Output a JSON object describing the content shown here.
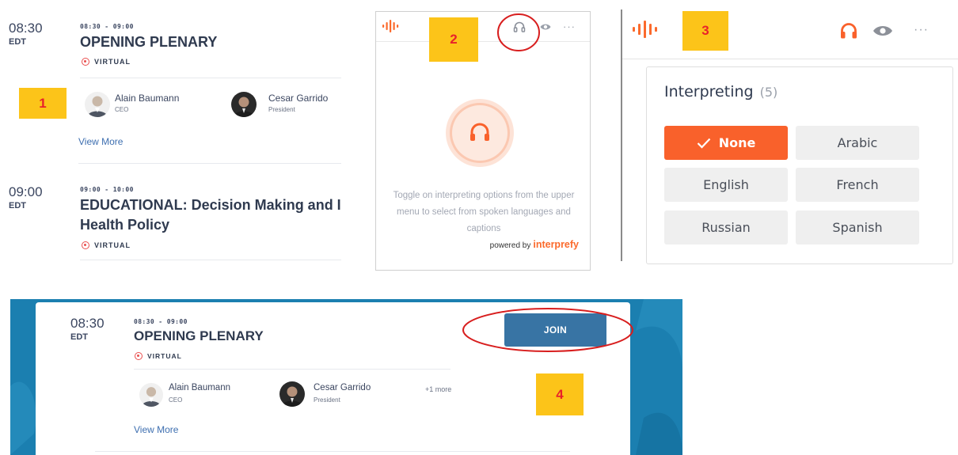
{
  "panel1": {
    "badge": "1",
    "slot1": {
      "time": "08:30",
      "tz": "EDT",
      "range": "08:30 - 09:00",
      "title": "OPENING PLENARY",
      "mode": "VIRTUAL",
      "speakers": [
        {
          "name": "Alain Baumann",
          "role": "CEO"
        },
        {
          "name": "Cesar Garrido",
          "role": "President"
        }
      ],
      "view_more": "View More"
    },
    "slot2": {
      "time": "09:00",
      "tz": "EDT",
      "range": "09:00 - 10:00",
      "title_line1": "EDUCATIONAL: Decision Making and I",
      "title_line2": "Health Policy",
      "mode": "VIRTUAL"
    }
  },
  "panel2": {
    "badge": "2",
    "help_text": "Toggle on interpreting options from the upper menu to select from spoken languages and captions",
    "powered_by": "powered by",
    "brand": "interprefy",
    "more": "···"
  },
  "panel3": {
    "badge": "3",
    "title": "Interpreting",
    "count": "(5)",
    "more": "···",
    "languages": [
      {
        "label": "None",
        "selected": true
      },
      {
        "label": "Arabic",
        "selected": false
      },
      {
        "label": "English",
        "selected": false
      },
      {
        "label": "French",
        "selected": false
      },
      {
        "label": "Russian",
        "selected": false
      },
      {
        "label": "Spanish",
        "selected": false
      }
    ]
  },
  "panel4": {
    "badge": "4",
    "time": "08:30",
    "tz": "EDT",
    "range": "08:30 - 09:00",
    "title": "OPENING PLENARY",
    "mode": "VIRTUAL",
    "speakers": [
      {
        "name": "Alain Baumann",
        "role": "CEO"
      },
      {
        "name": "Cesar Garrido",
        "role": "President"
      }
    ],
    "more_speakers": "+1 more",
    "view_more": "View More",
    "join": "JOIN"
  },
  "colors": {
    "accent_orange": "#f9612b",
    "join_blue": "#3874a4",
    "badge_yellow": "#fcc419",
    "badge_text_red": "#e8222a",
    "callout_red": "#d81e1e",
    "panel4_bg": "#1b7fb0"
  }
}
